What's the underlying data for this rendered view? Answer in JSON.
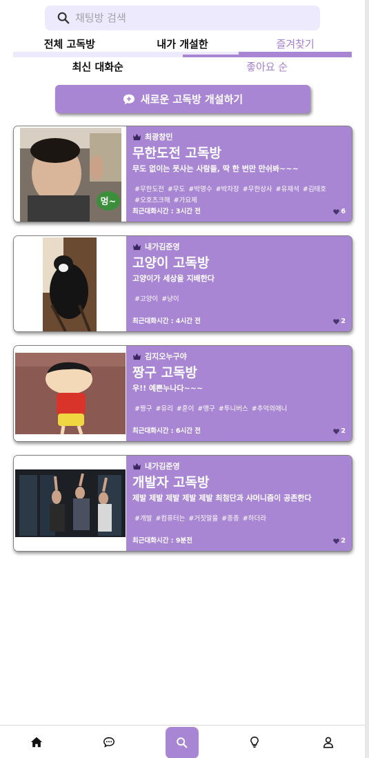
{
  "search": {
    "placeholder": "채팅방 검색"
  },
  "tabs": [
    {
      "label": "전체 고독방",
      "active": false
    },
    {
      "label": "내가 개설한",
      "active": false
    },
    {
      "label": "즐겨찾기",
      "active": true
    }
  ],
  "sort": [
    {
      "label": "최신 대화순",
      "active": false
    },
    {
      "label": "좋아요 순",
      "active": true
    }
  ],
  "new_room_button": {
    "label": "새로운 고독방 개설하기"
  },
  "rooms": [
    {
      "owner": "최광창민",
      "title": "무한도전 고독방",
      "description": "무도 없이는 못사는 사람들, 딱 한 번만 만쉬봐~~~",
      "tags": [
        "#무한도전",
        "#무도",
        "#박명수",
        "#박차장",
        "#무한상사",
        "#유재석",
        "#김태호",
        "#오호츠크해",
        "#가요제"
      ],
      "last_chat": "최근대화시간 : 3시간 전",
      "likes": "6",
      "thumb_caption": "멍~"
    },
    {
      "owner": "내가김준영",
      "title": "고양이 고독방",
      "description": "고양이가 세상을 지배한다",
      "tags": [
        "#고양이",
        "#냥이"
      ],
      "last_chat": "최근대화시간 : 4시간 전",
      "likes": "2"
    },
    {
      "owner": "김지오누구야",
      "title": "짱구 고독방",
      "description": "우!! 예쁜누나다~~~",
      "tags": [
        "#짱구",
        "#유리",
        "#훈이",
        "#맹구",
        "#투니버스",
        "#추억의애니"
      ],
      "last_chat": "최근대화시간 : 6시간 전",
      "likes": "2"
    },
    {
      "owner": "내가김준영",
      "title": "개발자 고독방",
      "description": "제발 제발 제발 제발 제발 최첨단과 샤머니즘이 공존한다",
      "tags": [
        "#개발",
        "#컴퓨터는",
        "#거짓말을",
        "#종종",
        "#하더라"
      ],
      "last_chat": "최근대화시간 : 9분전",
      "likes": "2"
    }
  ],
  "colors": {
    "accent": "#a886d4",
    "search_bg": "#eceafc"
  },
  "bottom_nav": [
    "home-icon",
    "chat-icon",
    "search-icon",
    "lightbulb-icon",
    "user-icon"
  ]
}
